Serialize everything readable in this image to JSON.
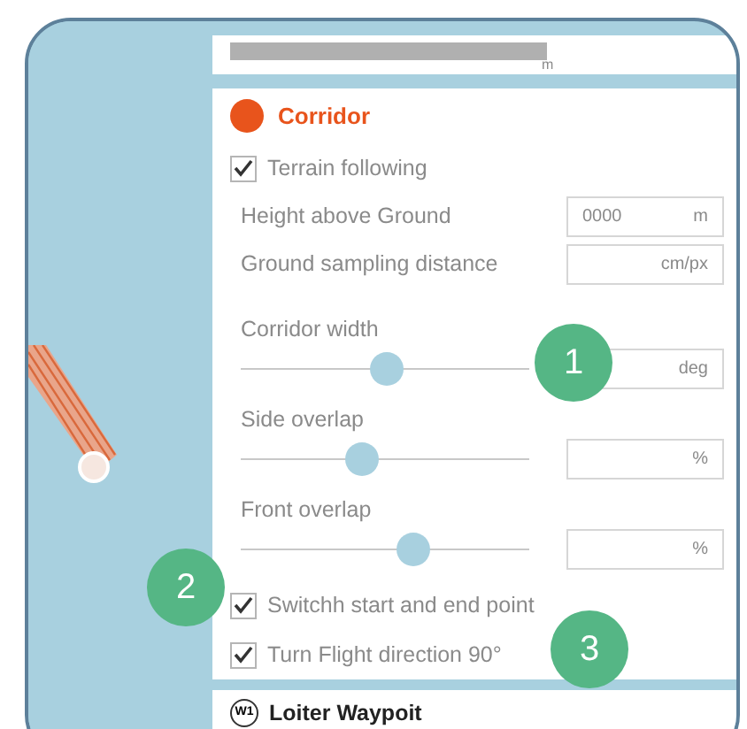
{
  "header_field": {
    "unit": "m"
  },
  "section": {
    "title": "Corridor",
    "color": "#e8541c",
    "items": [
      {
        "kind": "checkbox",
        "label": "Terrain following",
        "checked": true
      },
      {
        "kind": "input",
        "label": "Height above Ground",
        "placeholder": "0000",
        "unit": "m"
      },
      {
        "kind": "input",
        "label": "Ground sampling distance",
        "unit": "cm/px"
      },
      {
        "kind": "slider",
        "label": "Corridor width",
        "level": 0.51,
        "unit": "deg"
      },
      {
        "kind": "slider",
        "label": "Side overlap",
        "level": 0.41,
        "unit": "%"
      },
      {
        "kind": "slider",
        "label": "Front overlap",
        "level": 0.61,
        "unit": "%"
      },
      {
        "kind": "checkbox",
        "label": "Switchh start and end point",
        "checked": true
      },
      {
        "kind": "checkbox",
        "label": "Turn Flight direction 90°",
        "checked": true
      }
    ]
  },
  "next_section": {
    "icon_label": "W1",
    "title": "Loiter Waypoit"
  },
  "badges": [
    {
      "label": "1"
    },
    {
      "label": "2"
    },
    {
      "label": "3"
    }
  ]
}
